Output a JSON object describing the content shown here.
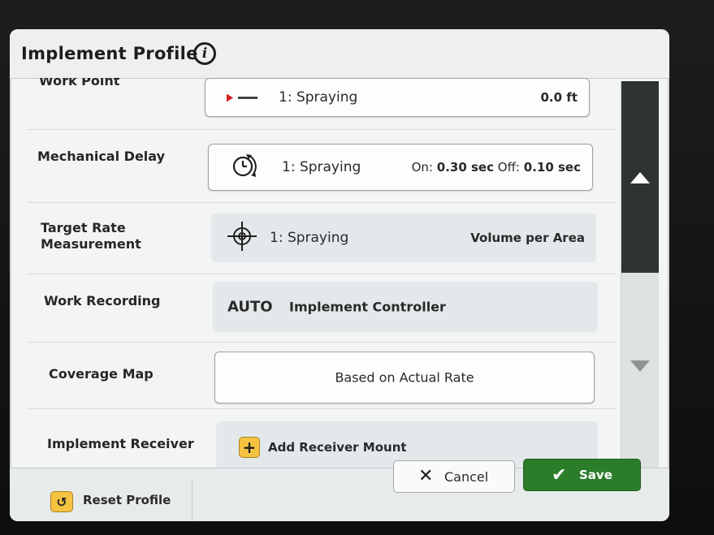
{
  "header": {
    "title": "Implement Profile",
    "info_icon": "info-icon"
  },
  "rows": {
    "work_point": {
      "label": "Work Point",
      "value": "1: Spraying",
      "right": "0.0 ft",
      "icon": "work-point-icon"
    },
    "mechanical_delay": {
      "label": "Mechanical Delay",
      "value": "1: Spraying",
      "on_label": "On:",
      "on_value": "0.30 sec",
      "off_label": "Off:",
      "off_value": "0.10 sec",
      "icon": "timer-icon"
    },
    "target_rate": {
      "label_line1": "Target Rate",
      "label_line2": "Measurement",
      "value": "1: Spraying",
      "right": "Volume per Area",
      "icon": "crosshair-icon"
    },
    "work_recording": {
      "label": "Work Recording",
      "mode": "AUTO",
      "value": "Implement Controller"
    },
    "coverage_map": {
      "label": "Coverage Map",
      "value": "Based on Actual Rate"
    },
    "implement_receiver": {
      "label": "Implement Receiver",
      "button": "Add Receiver Mount",
      "icon": "plus-icon"
    }
  },
  "footer": {
    "reset": "Reset Profile",
    "cancel": "Cancel",
    "save": "Save"
  },
  "colors": {
    "save": "#2b7d2a",
    "accent_yellow": "#f5c340",
    "work_point_marker": "#d22020"
  }
}
